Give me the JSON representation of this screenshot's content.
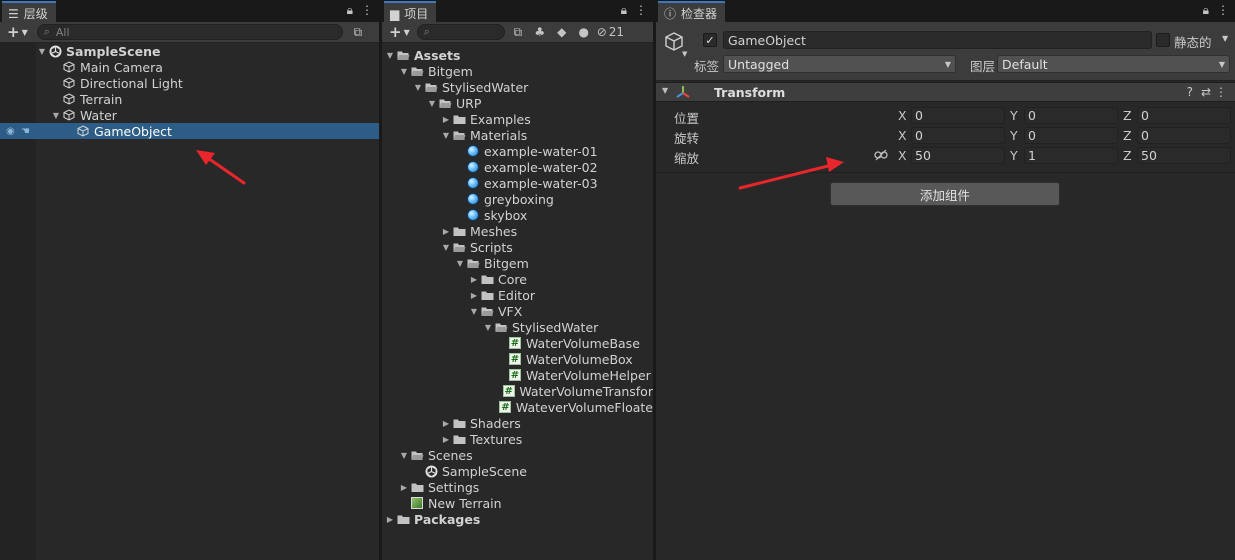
{
  "colors": {
    "accent": "#3a79bb",
    "selection": "#2c5d87",
    "annotation_arrow": "#e8262b"
  },
  "hierarchy": {
    "tab_label": "层级",
    "search_placeholder": "All",
    "rows": [
      {
        "label": "SampleScene",
        "icon": "unity-scene-icon",
        "depth": 0,
        "expand": "open",
        "bold": true
      },
      {
        "label": "Main Camera",
        "icon": "gameobject-cube-icon",
        "depth": 1,
        "expand": "none"
      },
      {
        "label": "Directional Light",
        "icon": "gameobject-cube-icon",
        "depth": 1,
        "expand": "none"
      },
      {
        "label": "Terrain",
        "icon": "gameobject-cube-icon",
        "depth": 1,
        "expand": "none"
      },
      {
        "label": "Water",
        "icon": "gameobject-cube-icon",
        "depth": 1,
        "expand": "open"
      },
      {
        "label": "GameObject",
        "icon": "gameobject-cube-icon",
        "depth": 2,
        "expand": "none",
        "selected": true
      }
    ]
  },
  "project": {
    "tab_label": "项目",
    "hidden_count": "21",
    "rows": [
      {
        "label": "Assets",
        "icon": "folder-open-icon",
        "depth": 0,
        "expand": "open",
        "bold": true
      },
      {
        "label": "Bitgem",
        "icon": "folder-open-icon",
        "depth": 1,
        "expand": "open"
      },
      {
        "label": "StylisedWater",
        "icon": "folder-open-icon",
        "depth": 2,
        "expand": "open"
      },
      {
        "label": "URP",
        "icon": "folder-open-icon",
        "depth": 3,
        "expand": "open"
      },
      {
        "label": "Examples",
        "icon": "folder-icon",
        "depth": 4,
        "expand": "closed"
      },
      {
        "label": "Materials",
        "icon": "folder-open-icon",
        "depth": 4,
        "expand": "open"
      },
      {
        "label": "example-water-01",
        "icon": "material-icon",
        "depth": 5,
        "expand": "none"
      },
      {
        "label": "example-water-02",
        "icon": "material-icon",
        "depth": 5,
        "expand": "none"
      },
      {
        "label": "example-water-03",
        "icon": "material-icon",
        "depth": 5,
        "expand": "none"
      },
      {
        "label": "greyboxing",
        "icon": "material-icon",
        "depth": 5,
        "expand": "none"
      },
      {
        "label": "skybox",
        "icon": "material-icon",
        "depth": 5,
        "expand": "none"
      },
      {
        "label": "Meshes",
        "icon": "folder-icon",
        "depth": 4,
        "expand": "closed"
      },
      {
        "label": "Scripts",
        "icon": "folder-open-icon",
        "depth": 4,
        "expand": "open"
      },
      {
        "label": "Bitgem",
        "icon": "folder-open-icon",
        "depth": 5,
        "expand": "open"
      },
      {
        "label": "Core",
        "icon": "folder-icon",
        "depth": 6,
        "expand": "closed"
      },
      {
        "label": "Editor",
        "icon": "folder-icon",
        "depth": 6,
        "expand": "closed"
      },
      {
        "label": "VFX",
        "icon": "folder-open-icon",
        "depth": 6,
        "expand": "open"
      },
      {
        "label": "StylisedWater",
        "icon": "folder-open-icon",
        "depth": 7,
        "expand": "open"
      },
      {
        "label": "WaterVolumeBase",
        "icon": "csharp-script-icon",
        "depth": 8,
        "expand": "none"
      },
      {
        "label": "WaterVolumeBox",
        "icon": "csharp-script-icon",
        "depth": 8,
        "expand": "none"
      },
      {
        "label": "WaterVolumeHelper",
        "icon": "csharp-script-icon",
        "depth": 8,
        "expand": "none"
      },
      {
        "label": "WaterVolumeTransfor",
        "icon": "csharp-script-icon",
        "depth": 8,
        "expand": "none"
      },
      {
        "label": "WateverVolumeFloate",
        "icon": "csharp-script-icon",
        "depth": 8,
        "expand": "none"
      },
      {
        "label": "Shaders",
        "icon": "folder-icon",
        "depth": 4,
        "expand": "closed"
      },
      {
        "label": "Textures",
        "icon": "folder-icon",
        "depth": 4,
        "expand": "closed"
      },
      {
        "label": "Scenes",
        "icon": "folder-open-icon",
        "depth": 1,
        "expand": "open"
      },
      {
        "label": "SampleScene",
        "icon": "unity-scene-icon",
        "depth": 2,
        "expand": "none"
      },
      {
        "label": "Settings",
        "icon": "folder-icon",
        "depth": 1,
        "expand": "closed"
      },
      {
        "label": "New Terrain",
        "icon": "terrain-icon",
        "depth": 1,
        "expand": "none"
      },
      {
        "label": "Packages",
        "icon": "folder-icon",
        "depth": 0,
        "expand": "closed",
        "bold": true
      }
    ]
  },
  "inspector": {
    "tab_label": "检查器",
    "object_name": "GameObject",
    "active": true,
    "static_label": "静态的",
    "tag_label": "标签",
    "tag_value": "Untagged",
    "layer_label": "图层",
    "layer_value": "Default",
    "component_title": "Transform",
    "position_label": "位置",
    "rotation_label": "旋转",
    "scale_label": "缩放",
    "axis_x": "X",
    "axis_y": "Y",
    "axis_z": "Z",
    "position": {
      "x": "0",
      "y": "0",
      "z": "0"
    },
    "rotation": {
      "x": "0",
      "y": "0",
      "z": "0"
    },
    "scale": {
      "x": "50",
      "y": "1",
      "z": "50"
    },
    "add_component_label": "添加组件"
  }
}
